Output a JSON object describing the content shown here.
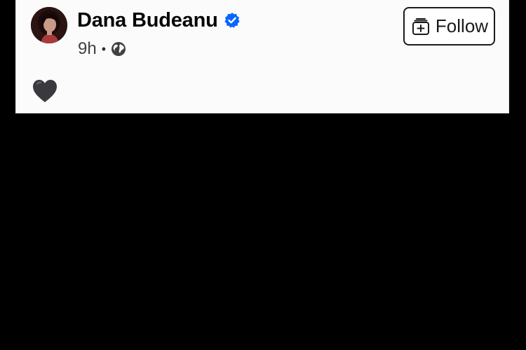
{
  "post": {
    "author": {
      "name": "Dana Budeanu",
      "verified": true,
      "avatar_icon": "profile-photo"
    },
    "meta": {
      "time": "9h",
      "separator": "•",
      "audience_icon": "globe-icon"
    },
    "follow_button": {
      "label": "Follow",
      "icon": "follow-plus-icon"
    },
    "content": {
      "emoji": "black-heart",
      "emoji_color": "#3a3a3e"
    }
  },
  "colors": {
    "card_background": "#fbfbfb",
    "verified_blue": "#0866ff",
    "text_primary": "#050505",
    "below_post_background": "#000000"
  }
}
